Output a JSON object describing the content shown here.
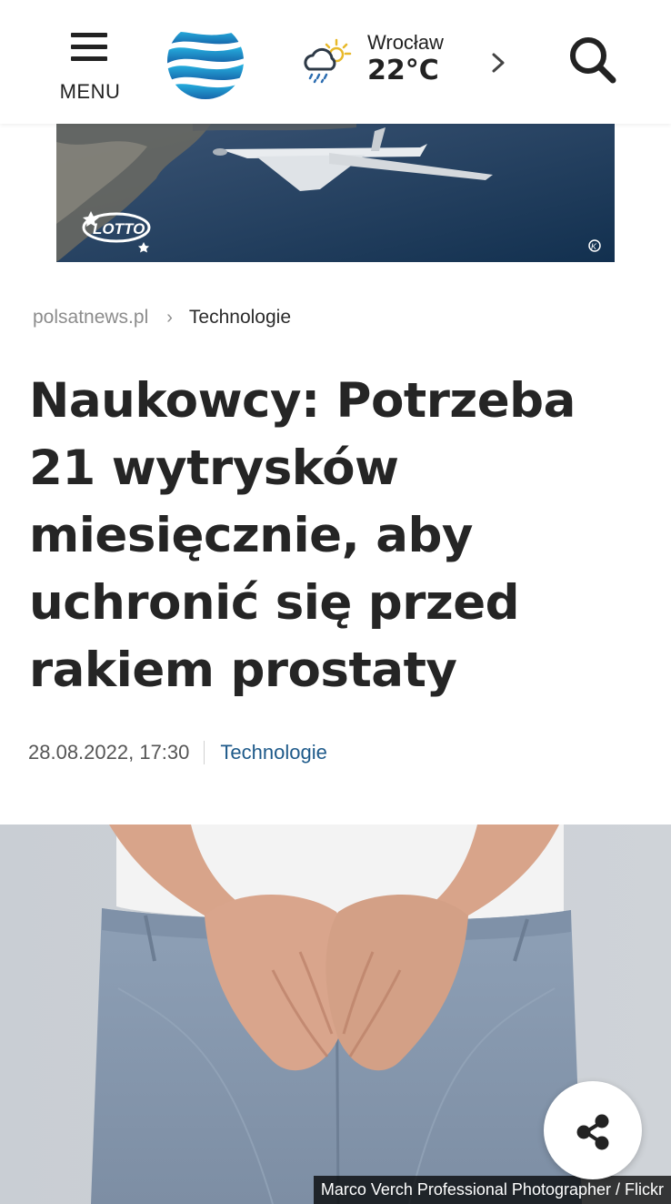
{
  "header": {
    "menu_label": "MENU",
    "weather": {
      "city": "Wrocław",
      "temperature": "22°C",
      "icon": "cloud-rain-sun-icon"
    }
  },
  "ad": {
    "brand": "LOTTO"
  },
  "breadcrumb": {
    "site": "polsatnews.pl",
    "separator": "›",
    "category": "Technologie"
  },
  "article": {
    "title": "Naukowcy: Potrzeba 21 wytrysków miesięcznie, aby uchronić się przed rakiem prostaty",
    "title_lines": [
      "Naukowcy: Potrzeba",
      "21 wytrysków",
      "miesięcznie, aby",
      "uchronić się przed",
      "rakiem prostaty"
    ],
    "date": "28.08.2022, 17:30",
    "category": "Technologie"
  },
  "photo": {
    "credit": "Marco Verch Professional Photographer / Flickr"
  },
  "colors": {
    "accent": "#1e5a8a",
    "text": "#252525",
    "muted": "#8c8c8c"
  }
}
